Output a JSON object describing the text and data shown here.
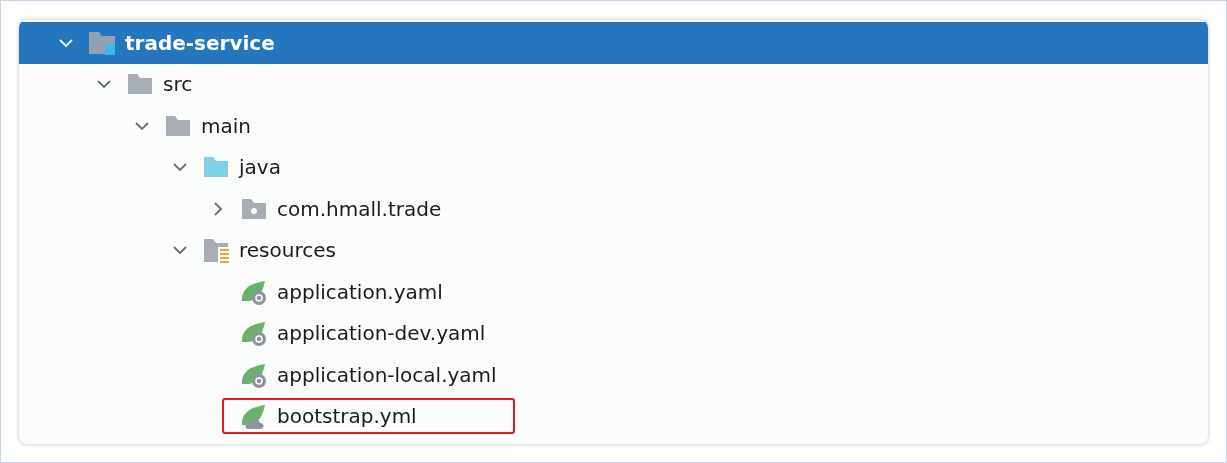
{
  "project_tree": [
    {
      "label": "trade-service",
      "kind": "module",
      "expanded": true,
      "selected": true,
      "children": [
        {
          "label": "src",
          "kind": "folder",
          "expanded": true,
          "selected": false,
          "children": [
            {
              "label": "main",
              "kind": "folder",
              "expanded": true,
              "selected": false,
              "children": [
                {
                  "label": "java",
                  "kind": "source-folder",
                  "expanded": true,
                  "selected": false,
                  "children": [
                    {
                      "label": "com.hmall.trade",
                      "kind": "package",
                      "expanded": false,
                      "selected": false
                    }
                  ]
                },
                {
                  "label": "resources",
                  "kind": "resources-folder",
                  "expanded": true,
                  "selected": false,
                  "children": [
                    {
                      "label": "application.yaml",
                      "kind": "spring-config",
                      "selected": false,
                      "highlighted": false
                    },
                    {
                      "label": "application-dev.yaml",
                      "kind": "spring-config",
                      "selected": false,
                      "highlighted": false
                    },
                    {
                      "label": "application-local.yaml",
                      "kind": "spring-config",
                      "selected": false,
                      "highlighted": false
                    },
                    {
                      "label": "bootstrap.yml",
                      "kind": "spring-bootstrap",
                      "selected": false,
                      "highlighted": true
                    }
                  ]
                }
              ]
            }
          ]
        }
      ]
    }
  ]
}
